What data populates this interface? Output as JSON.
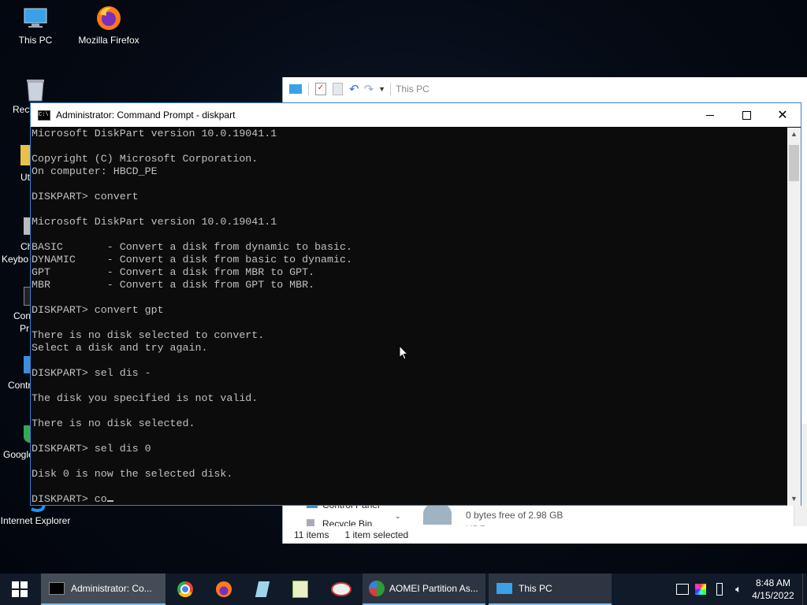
{
  "desktop": {
    "icons": [
      {
        "label": "This PC"
      },
      {
        "label": "Mozilla Firefox"
      },
      {
        "label": "Recy"
      },
      {
        "label": "Ut"
      },
      {
        "label": "Ch"
      },
      {
        "label": "Keybo"
      },
      {
        "label": "Con"
      },
      {
        "label": "Pr"
      },
      {
        "label": "Contr"
      },
      {
        "label": "Google"
      },
      {
        "label": "Internet Explorer"
      }
    ]
  },
  "explorer": {
    "title": "This PC",
    "nav_items": [
      "Control Panel",
      "Recycle Bin"
    ],
    "drive_free": "0 bytes free of 2.98 GB",
    "drive_fs": "UDF",
    "status_count": "11 items",
    "status_selected": "1 item selected"
  },
  "cmd": {
    "title": "Administrator: Command Prompt - diskpart",
    "console_lines": [
      "Microsoft DiskPart version 10.0.19041.1",
      "",
      "Copyright (C) Microsoft Corporation.",
      "On computer: HBCD_PE",
      "",
      "DISKPART> convert",
      "",
      "Microsoft DiskPart version 10.0.19041.1",
      "",
      "BASIC       - Convert a disk from dynamic to basic.",
      "DYNAMIC     - Convert a disk from basic to dynamic.",
      "GPT         - Convert a disk from MBR to GPT.",
      "MBR         - Convert a disk from GPT to MBR.",
      "",
      "DISKPART> convert gpt",
      "",
      "There is no disk selected to convert.",
      "Select a disk and try again.",
      "",
      "DISKPART> sel dis -",
      "",
      "The disk you specified is not valid.",
      "",
      "There is no disk selected.",
      "",
      "DISKPART> sel dis 0",
      "",
      "Disk 0 is now the selected disk.",
      ""
    ],
    "prompt": "DISKPART> ",
    "input_value": "co"
  },
  "taskbar": {
    "apps": [
      {
        "label": "Administrator: Co..."
      },
      {
        "label": "AOMEI Partition As..."
      },
      {
        "label": "This PC"
      }
    ],
    "time": "8:48 AM",
    "date": "4/15/2022"
  },
  "colors": {
    "accent": "#0078d7",
    "console_bg": "#0c0c0c",
    "console_fg": "#c0c0c0",
    "taskbar_bg": "#101a28"
  }
}
